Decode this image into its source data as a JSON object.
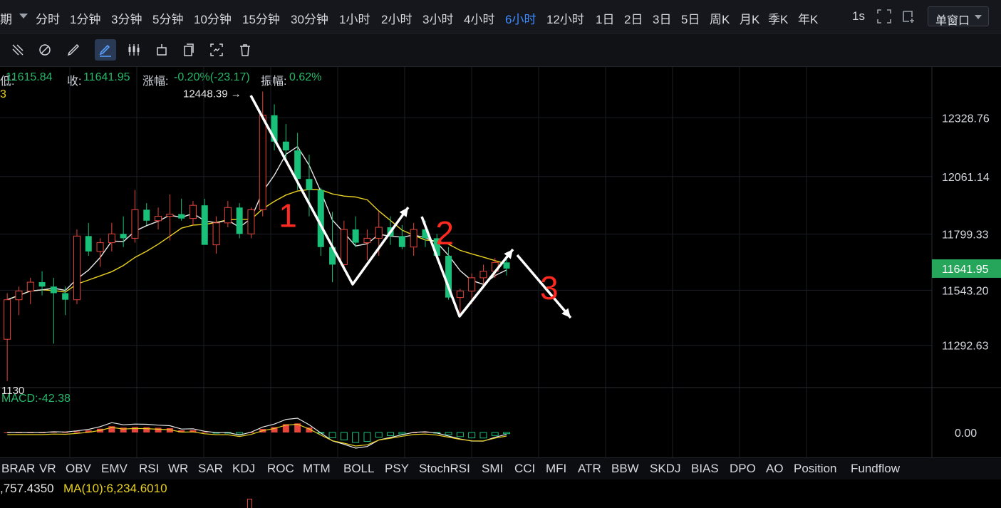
{
  "timeframes": {
    "period_label": "期",
    "items": [
      "分时",
      "1分钟",
      "3分钟",
      "5分钟",
      "10分钟",
      "15分钟",
      "30分钟",
      "1小时",
      "2小时",
      "3小时",
      "4小时",
      "6小时",
      "12小时",
      "1日",
      "2日",
      "3日",
      "5日",
      "周K",
      "月K",
      "季K",
      "年K"
    ],
    "active": "6小时",
    "seconds_label": "1s"
  },
  "window_mode": {
    "label": "单窗口"
  },
  "tools": [
    "ruler-icon",
    "eraser-icon",
    "pencil-icon",
    "draw-mode-icon",
    "candles-icon",
    "marker-icon",
    "copy-icon",
    "screenshot-icon",
    "trash-icon"
  ],
  "info_bar": {
    "low_label": "低:",
    "low_value": "11615.84",
    "close_label": "收:",
    "close_value": "11641.95",
    "change_label": "涨幅:",
    "change_value": "-0.20%(-23.17)",
    "amplitude_label": "振幅:",
    "amplitude_value": "0.62%",
    "yellow_fragment": "3"
  },
  "colors": {
    "up": "#e8453c",
    "down": "#18c07a",
    "ma_fast": "#e6e6e6",
    "ma_slow": "#e8d022",
    "accent": "#3d8bff",
    "price_tag": "#26a65b"
  },
  "chart_data": {
    "type": "candlestick",
    "y_ticks": [
      "12328.76",
      "12061.14",
      "11799.33",
      "11543.20",
      "11292.63"
    ],
    "ylim": [
      11100,
      12560
    ],
    "current_price": "11641.95",
    "high_marker": "12448.39",
    "low_marker": "1130",
    "candles": [
      {
        "o": 11320,
        "h": 11530,
        "l": 11130,
        "c": 11500
      },
      {
        "o": 11500,
        "h": 11560,
        "l": 11430,
        "c": 11540
      },
      {
        "o": 11540,
        "h": 11600,
        "l": 11480,
        "c": 11580
      },
      {
        "o": 11580,
        "h": 11630,
        "l": 11520,
        "c": 11560
      },
      {
        "o": 11560,
        "h": 11600,
        "l": 11300,
        "c": 11530
      },
      {
        "o": 11530,
        "h": 11560,
        "l": 11430,
        "c": 11500
      },
      {
        "o": 11500,
        "h": 11820,
        "l": 11480,
        "c": 11790
      },
      {
        "o": 11790,
        "h": 11850,
        "l": 11700,
        "c": 11720
      },
      {
        "o": 11720,
        "h": 11780,
        "l": 11650,
        "c": 11760
      },
      {
        "o": 11760,
        "h": 11850,
        "l": 11720,
        "c": 11800
      },
      {
        "o": 11800,
        "h": 11880,
        "l": 11740,
        "c": 11780
      },
      {
        "o": 11780,
        "h": 12000,
        "l": 11760,
        "c": 11910
      },
      {
        "o": 11910,
        "h": 11940,
        "l": 11840,
        "c": 11860
      },
      {
        "o": 11860,
        "h": 11920,
        "l": 11820,
        "c": 11880
      },
      {
        "o": 11880,
        "h": 11980,
        "l": 11770,
        "c": 11890
      },
      {
        "o": 11890,
        "h": 11960,
        "l": 11860,
        "c": 11870
      },
      {
        "o": 11870,
        "h": 11950,
        "l": 11840,
        "c": 11930
      },
      {
        "o": 11930,
        "h": 11960,
        "l": 11760,
        "c": 11750
      },
      {
        "o": 11750,
        "h": 11880,
        "l": 11710,
        "c": 11850
      },
      {
        "o": 11850,
        "h": 11950,
        "l": 11830,
        "c": 11920
      },
      {
        "o": 11920,
        "h": 11940,
        "l": 11780,
        "c": 11800
      },
      {
        "o": 11800,
        "h": 11920,
        "l": 11780,
        "c": 11910
      },
      {
        "o": 11910,
        "h": 12448,
        "l": 11880,
        "c": 12340
      },
      {
        "o": 12340,
        "h": 12390,
        "l": 12180,
        "c": 12220
      },
      {
        "o": 12220,
        "h": 12300,
        "l": 12140,
        "c": 12180
      },
      {
        "o": 12180,
        "h": 12260,
        "l": 12000,
        "c": 12050
      },
      {
        "o": 12050,
        "h": 12160,
        "l": 11880,
        "c": 12000
      },
      {
        "o": 12000,
        "h": 12010,
        "l": 11700,
        "c": 11740
      },
      {
        "o": 11740,
        "h": 11900,
        "l": 11580,
        "c": 11660
      },
      {
        "o": 11660,
        "h": 11860,
        "l": 11640,
        "c": 11820
      },
      {
        "o": 11820,
        "h": 11880,
        "l": 11740,
        "c": 11760
      },
      {
        "o": 11760,
        "h": 11820,
        "l": 11680,
        "c": 11780
      },
      {
        "o": 11780,
        "h": 11900,
        "l": 11700,
        "c": 11830
      },
      {
        "o": 11830,
        "h": 11880,
        "l": 11750,
        "c": 11790
      },
      {
        "o": 11790,
        "h": 11840,
        "l": 11730,
        "c": 11740
      },
      {
        "o": 11740,
        "h": 11850,
        "l": 11700,
        "c": 11820
      },
      {
        "o": 11820,
        "h": 11860,
        "l": 11740,
        "c": 11780
      },
      {
        "o": 11780,
        "h": 11800,
        "l": 11680,
        "c": 11700
      },
      {
        "o": 11700,
        "h": 11740,
        "l": 11500,
        "c": 11510
      },
      {
        "o": 11510,
        "h": 11550,
        "l": 11440,
        "c": 11540
      },
      {
        "o": 11540,
        "h": 11620,
        "l": 11480,
        "c": 11600
      },
      {
        "o": 11600,
        "h": 11660,
        "l": 11560,
        "c": 11630
      },
      {
        "o": 11630,
        "h": 11690,
        "l": 11600,
        "c": 11670
      },
      {
        "o": 11670,
        "h": 11700,
        "l": 11610,
        "c": 11642
      }
    ],
    "annotations": [
      {
        "label": "1",
        "x": 11,
        "y": 11890
      },
      {
        "label": "2",
        "x": 24.5,
        "y": 11810
      },
      {
        "label": "3",
        "x": 33.5,
        "y": 11560
      }
    ],
    "macd": {
      "label": "MACD:-42.38",
      "zero_label": "0.00"
    }
  },
  "indicator_tabs": [
    "BRAR",
    "VR",
    "OBV",
    "EMV",
    "RSI",
    "WR",
    "SAR",
    "KDJ",
    "ROC",
    "MTM",
    "BOLL",
    "PSY",
    "StochRSI",
    "SMI",
    "CCI",
    "MFI",
    "ATR",
    "BBW",
    "SKDJ",
    "BIAS",
    "DPO",
    "AO",
    "Position",
    "Fundflow"
  ],
  "volume": {
    "ma5_fragment": ",757.4350",
    "ma10_label": "MA(10):6,234.6010"
  }
}
